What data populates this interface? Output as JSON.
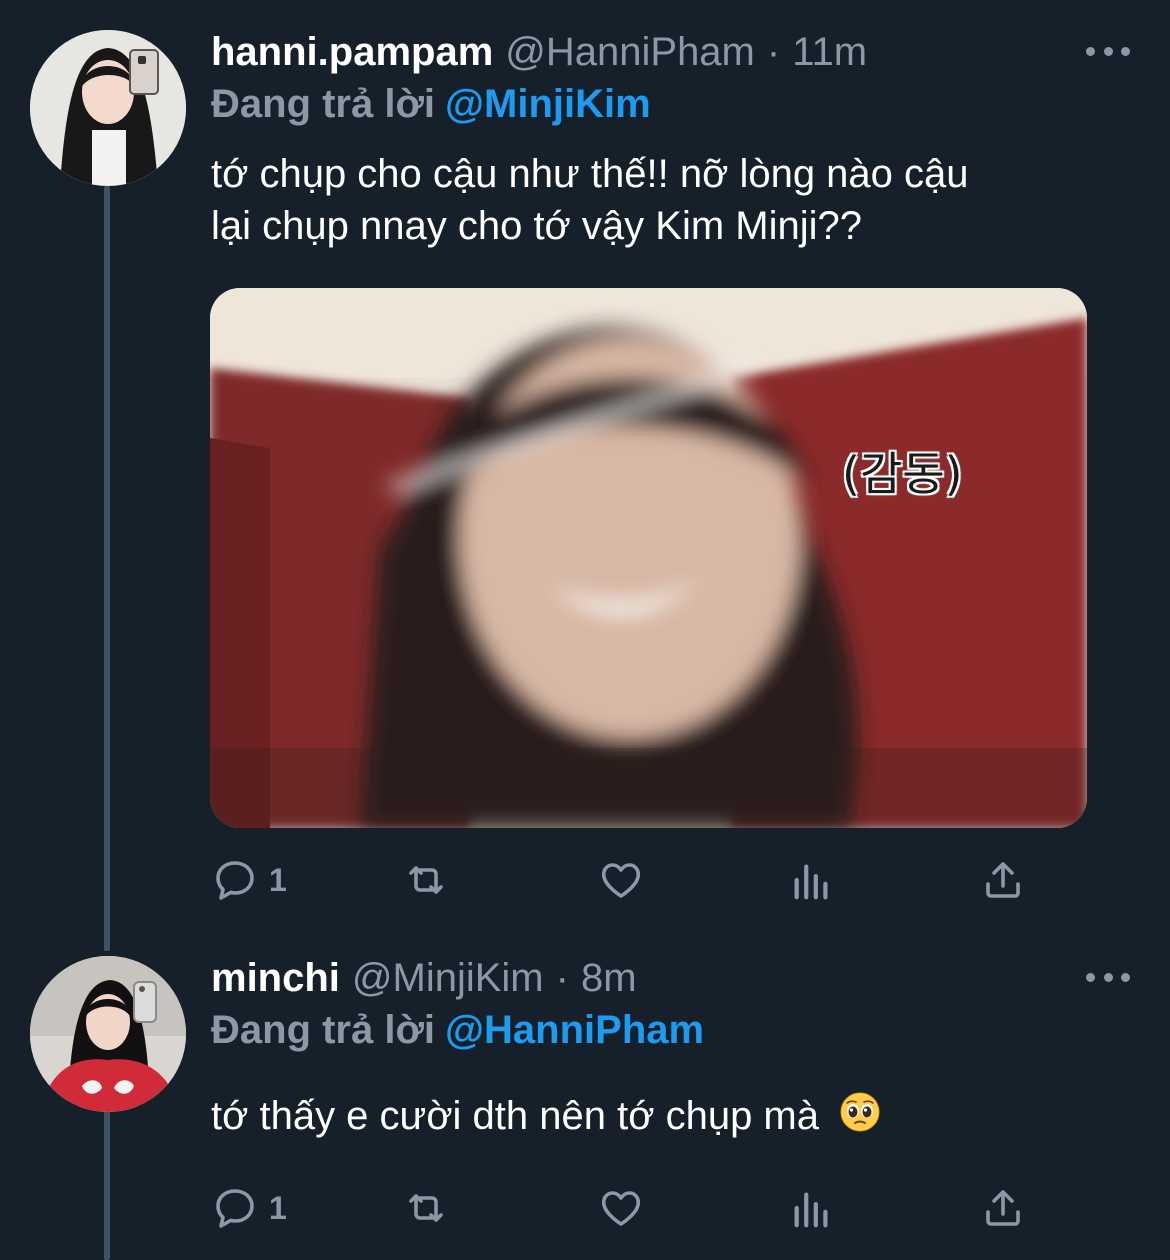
{
  "tweets": [
    {
      "display_name": "hanni.pampam",
      "handle": "@HanniPham",
      "separator": "·",
      "time": "11m",
      "reply_prefix": "Đang trả lời",
      "reply_to": "@MinjiKim",
      "text_line1": "tớ chụp cho cậu như thế!! nỡ lòng nào cậu",
      "text_line2": "lại chụp nnay cho tớ vậy Kim Minji??",
      "media_caption": "(감동)",
      "reply_count": "1",
      "icons": [
        "reply-icon",
        "retweet-icon",
        "like-icon",
        "views-icon",
        "share-icon"
      ]
    },
    {
      "display_name": "minchi",
      "handle": "@MinjiKim",
      "separator": "·",
      "time": "8m",
      "reply_prefix": "Đang trả lời",
      "reply_to": "@HanniPham",
      "text_line1": "tớ thấy e cười dth nên tớ chụp mà",
      "emoji": "pleading-face-emoji",
      "reply_count": "1",
      "icons": [
        "reply-icon",
        "retweet-icon",
        "like-icon",
        "views-icon",
        "share-icon"
      ]
    }
  ],
  "colors": {
    "background": "#15202b",
    "secondary_text": "#8b98a5",
    "link": "#1d9bf0",
    "thread_line": "#3d5466"
  }
}
